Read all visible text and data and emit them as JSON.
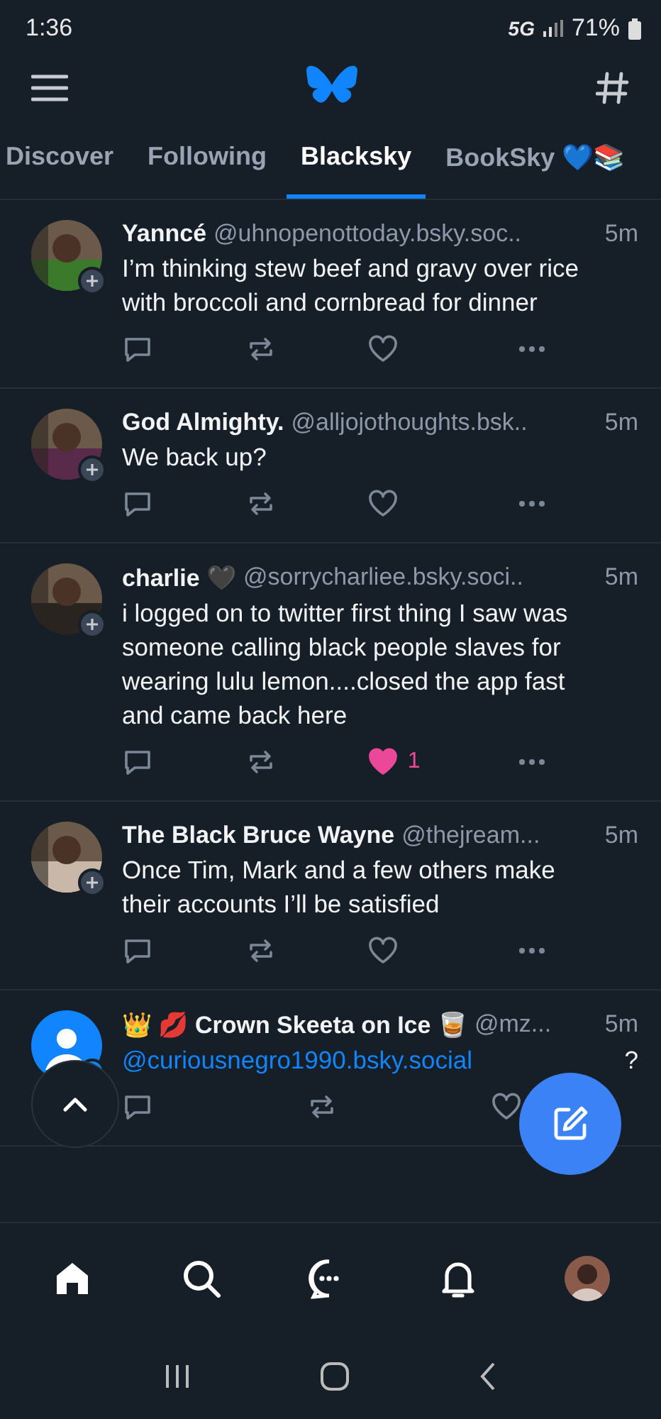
{
  "status_bar": {
    "time": "1:36",
    "network": "5G",
    "battery": "71%"
  },
  "tabs": [
    {
      "label": "Discover",
      "selected": false
    },
    {
      "label": "Following",
      "selected": false
    },
    {
      "label": "Blacksky",
      "selected": true
    },
    {
      "label": "BookSky 💙📚",
      "selected": false
    }
  ],
  "posts": [
    {
      "name": "Yanncé",
      "handle": "@uhnopenottoday.bsky.soc..",
      "time": "5m",
      "text": "I’m thinking stew beef and gravy over rice with broccoli and cornbread for dinner",
      "liked": false
    },
    {
      "name": "God Almighty.",
      "handle": "@alljojothoughts.bsk..",
      "time": "5m",
      "text": "We back up?",
      "liked": false
    },
    {
      "name": "charlie 🖤",
      "handle": "@sorrycharliee.bsky.soci..",
      "time": "5m",
      "text": "i logged on to twitter first thing I saw was someone calling black people slaves for wearing lulu lemon....closed the app fast and came back here",
      "liked": true,
      "like_count": "1"
    },
    {
      "name": "The Black Bruce Wayne",
      "handle": "@thejream...",
      "time": "5m",
      "text": "Once Tim, Mark and a few others make their accounts I’ll be satisfied",
      "liked": false
    },
    {
      "avatar": {
        "kind": "default"
      },
      "name": "👑 💋 Crown Skeeta on Ice 🥃",
      "handle": "@mz...",
      "time": "5m",
      "mention": "@curiousnegro1990.bsky.social",
      "text": "?",
      "liked": false
    }
  ]
}
